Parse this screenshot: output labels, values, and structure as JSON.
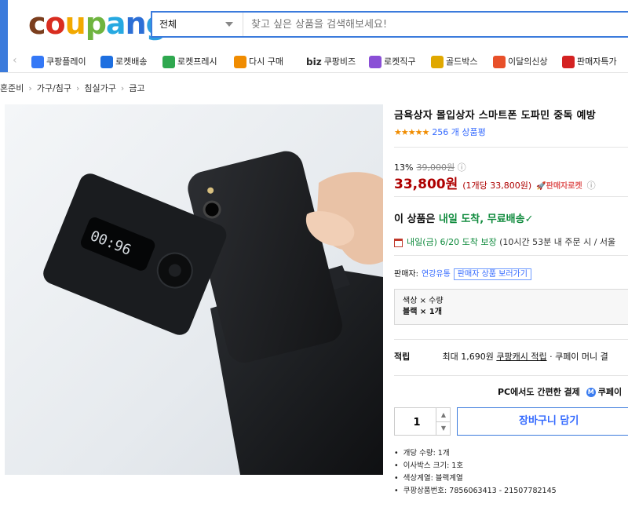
{
  "header": {
    "logo": [
      "c",
      "o",
      "u",
      "p",
      "a",
      "n",
      "g"
    ],
    "logo_colors": [
      "#7b3e1e",
      "#d92d20",
      "#f2a900",
      "#6fb43f",
      "#27a9e1",
      "#2c6fd6",
      "#2c9ee0"
    ],
    "search": {
      "category": "전체",
      "placeholder": "찾고 싶은 상품을 검색해보세요!"
    },
    "nav": [
      {
        "label": "쿠팡플레이",
        "icon": "play-icon",
        "color": "#3478f6"
      },
      {
        "label": "로켓배송",
        "icon": "rocket-icon",
        "color": "#1e6fe0"
      },
      {
        "label": "로켓프레시",
        "icon": "rocket-fresh-icon",
        "color": "#2fa84f"
      },
      {
        "label": "다시 구매",
        "icon": "basket-icon",
        "color": "#f08c00"
      },
      {
        "label": "쿠팡비즈",
        "icon": "biz-icon",
        "color": "#2b2b2b",
        "prefix": "biz"
      },
      {
        "label": "로켓직구",
        "icon": "rocket-global-icon",
        "color": "#8a4fd6"
      },
      {
        "label": "골드박스",
        "icon": "gold-box-icon",
        "color": "#e0a800"
      },
      {
        "label": "이달의신상",
        "icon": "new-bag-icon",
        "color": "#e8502a"
      },
      {
        "label": "판매자특가",
        "icon": "percent-icon",
        "color": "#d42222"
      }
    ]
  },
  "breadcrumb": [
    "혼준비",
    "가구/침구",
    "침실가구",
    "금고"
  ],
  "product": {
    "title": "금욕상자 몰입상자 스마트폰 도파민 중독 예방",
    "rating_stars": "★★★★★",
    "review_count": "256 개 상품평",
    "discount_rate": "13%",
    "original_price": "39,000원",
    "info_icon": "ⓘ",
    "price": "33,800원",
    "unit_price": "(1개당 33,800원)",
    "seller_rocket": "🚀판매자로켓",
    "delivery_prefix": "이 상품은",
    "delivery_main": "내일 도착, 무료배송",
    "delivery_check": "✓",
    "arrival": "내일(금) 6/20 도착 보장",
    "arrival_note": "(10시간 53분 내 주문 시 / 서울",
    "seller_label": "판매자:",
    "seller_name": "연강유통",
    "seller_link": "판매자 상품 보러가기",
    "option_label": "색상 × 수량",
    "option_value": "블랙 × 1개",
    "points_label": "적립",
    "points_max": "최대 1,690원",
    "points_link": "쿠팡캐시 적립",
    "points_rest": "· 쿠페이 머니 결",
    "pay_text": "PC에서도 간편한 결제",
    "pay_brand": "쿠페이",
    "quantity": "1",
    "cart_button": "장바구니 담기",
    "details": [
      "개당 수량: 1개",
      "이사박스 크기: 1호",
      "색상계열: 블랙계열",
      "쿠팡상품번호: 7856063413 - 21507782145"
    ],
    "device_display": "00:96"
  },
  "colors": {
    "accent": "#346aff",
    "price": "#ae0000",
    "delivery_green": "#0e8a3c"
  }
}
